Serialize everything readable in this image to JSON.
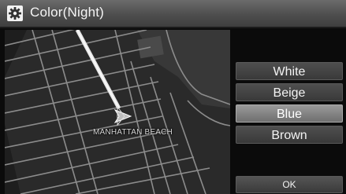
{
  "header": {
    "title": "Color(Night)",
    "icon": "gear-icon"
  },
  "map": {
    "place_label": "MANHATTAN BEACH"
  },
  "color_options": [
    {
      "label": "White",
      "selected": false
    },
    {
      "label": "Beige",
      "selected": false
    },
    {
      "label": "Blue",
      "selected": true
    },
    {
      "label": "Brown",
      "selected": false
    }
  ],
  "footer": {
    "ok_label": "OK"
  },
  "colors": {
    "title_bar": "#5a5a5a",
    "map_background": "#2a2a2a",
    "road": "#8a8a8a",
    "button": "#444444",
    "button_selected": "#8a8a8a"
  }
}
